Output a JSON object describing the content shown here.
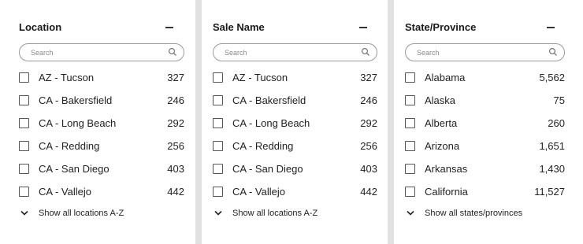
{
  "filters": [
    {
      "title": "Location",
      "search_placeholder": "Search",
      "collapse_icon": "minus-icon",
      "items": [
        {
          "label": "AZ - Tucson",
          "count": "327",
          "checked": false
        },
        {
          "label": "CA - Bakersfield",
          "count": "246",
          "checked": false
        },
        {
          "label": "CA - Long Beach",
          "count": "292",
          "checked": false
        },
        {
          "label": "CA - Redding",
          "count": "256",
          "checked": false
        },
        {
          "label": "CA - San Diego",
          "count": "403",
          "checked": false
        },
        {
          "label": "CA - Vallejo",
          "count": "442",
          "checked": false
        }
      ],
      "show_all_label": "Show all locations A-Z"
    },
    {
      "title": "Sale Name",
      "search_placeholder": "Search",
      "collapse_icon": "minus-icon",
      "items": [
        {
          "label": "AZ - Tucson",
          "count": "327",
          "checked": false
        },
        {
          "label": "CA - Bakersfield",
          "count": "246",
          "checked": false
        },
        {
          "label": "CA - Long Beach",
          "count": "292",
          "checked": false
        },
        {
          "label": "CA - Redding",
          "count": "256",
          "checked": false
        },
        {
          "label": "CA - San Diego",
          "count": "403",
          "checked": false
        },
        {
          "label": "CA - Vallejo",
          "count": "442",
          "checked": false
        }
      ],
      "show_all_label": "Show all locations A-Z"
    },
    {
      "title": "State/Province",
      "search_placeholder": "Search",
      "collapse_icon": "minus-icon",
      "items": [
        {
          "label": "Alabama",
          "count": "5,562",
          "checked": false
        },
        {
          "label": "Alaska",
          "count": "75",
          "checked": false
        },
        {
          "label": "Alberta",
          "count": "260",
          "checked": false
        },
        {
          "label": "Arizona",
          "count": "1,651",
          "checked": false
        },
        {
          "label": "Arkansas",
          "count": "1,430",
          "checked": false
        },
        {
          "label": "California",
          "count": "11,527",
          "checked": false
        }
      ],
      "show_all_label": "Show all states/provinces"
    }
  ],
  "colors": {
    "background": "#e1e1e1",
    "panel": "#ffffff",
    "text": "#222222",
    "border": "#9a9a9a"
  }
}
